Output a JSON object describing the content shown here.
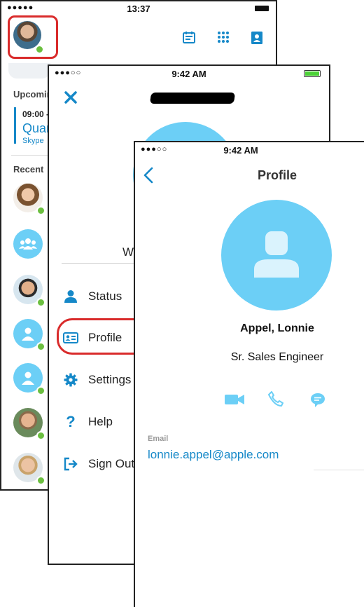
{
  "screen1": {
    "status_dots": "●●●●●",
    "time": "13:37",
    "upcoming_label": "Upcoming",
    "meeting": {
      "time": "09:00 -",
      "title": "Quar",
      "subtitle": "Skype"
    },
    "recent_label": "Recent"
  },
  "screen2": {
    "status_dots": "●●●○○",
    "time": "9:42 AM",
    "partial_name": "W",
    "menu": [
      {
        "label": "Status",
        "icon": "person-icon"
      },
      {
        "label": "Profile",
        "icon": "profile-card-icon"
      },
      {
        "label": "Settings",
        "icon": "gear-icon"
      },
      {
        "label": "Help",
        "icon": "question-icon"
      },
      {
        "label": "Sign Out",
        "icon": "sign-out-icon"
      }
    ]
  },
  "screen3": {
    "status_dots": "●●●○○",
    "time": "9:42 AM",
    "title": "Profile",
    "name": "Appel, Lonnie",
    "job_title": "Sr. Sales Engineer",
    "email_label": "Email",
    "email": "lonnie.appel@apple.com"
  },
  "colors": {
    "accent": "#1588c8",
    "avatar": "#6ccff6",
    "highlight": "#d92b2b",
    "presence": "#6bbf3f"
  }
}
